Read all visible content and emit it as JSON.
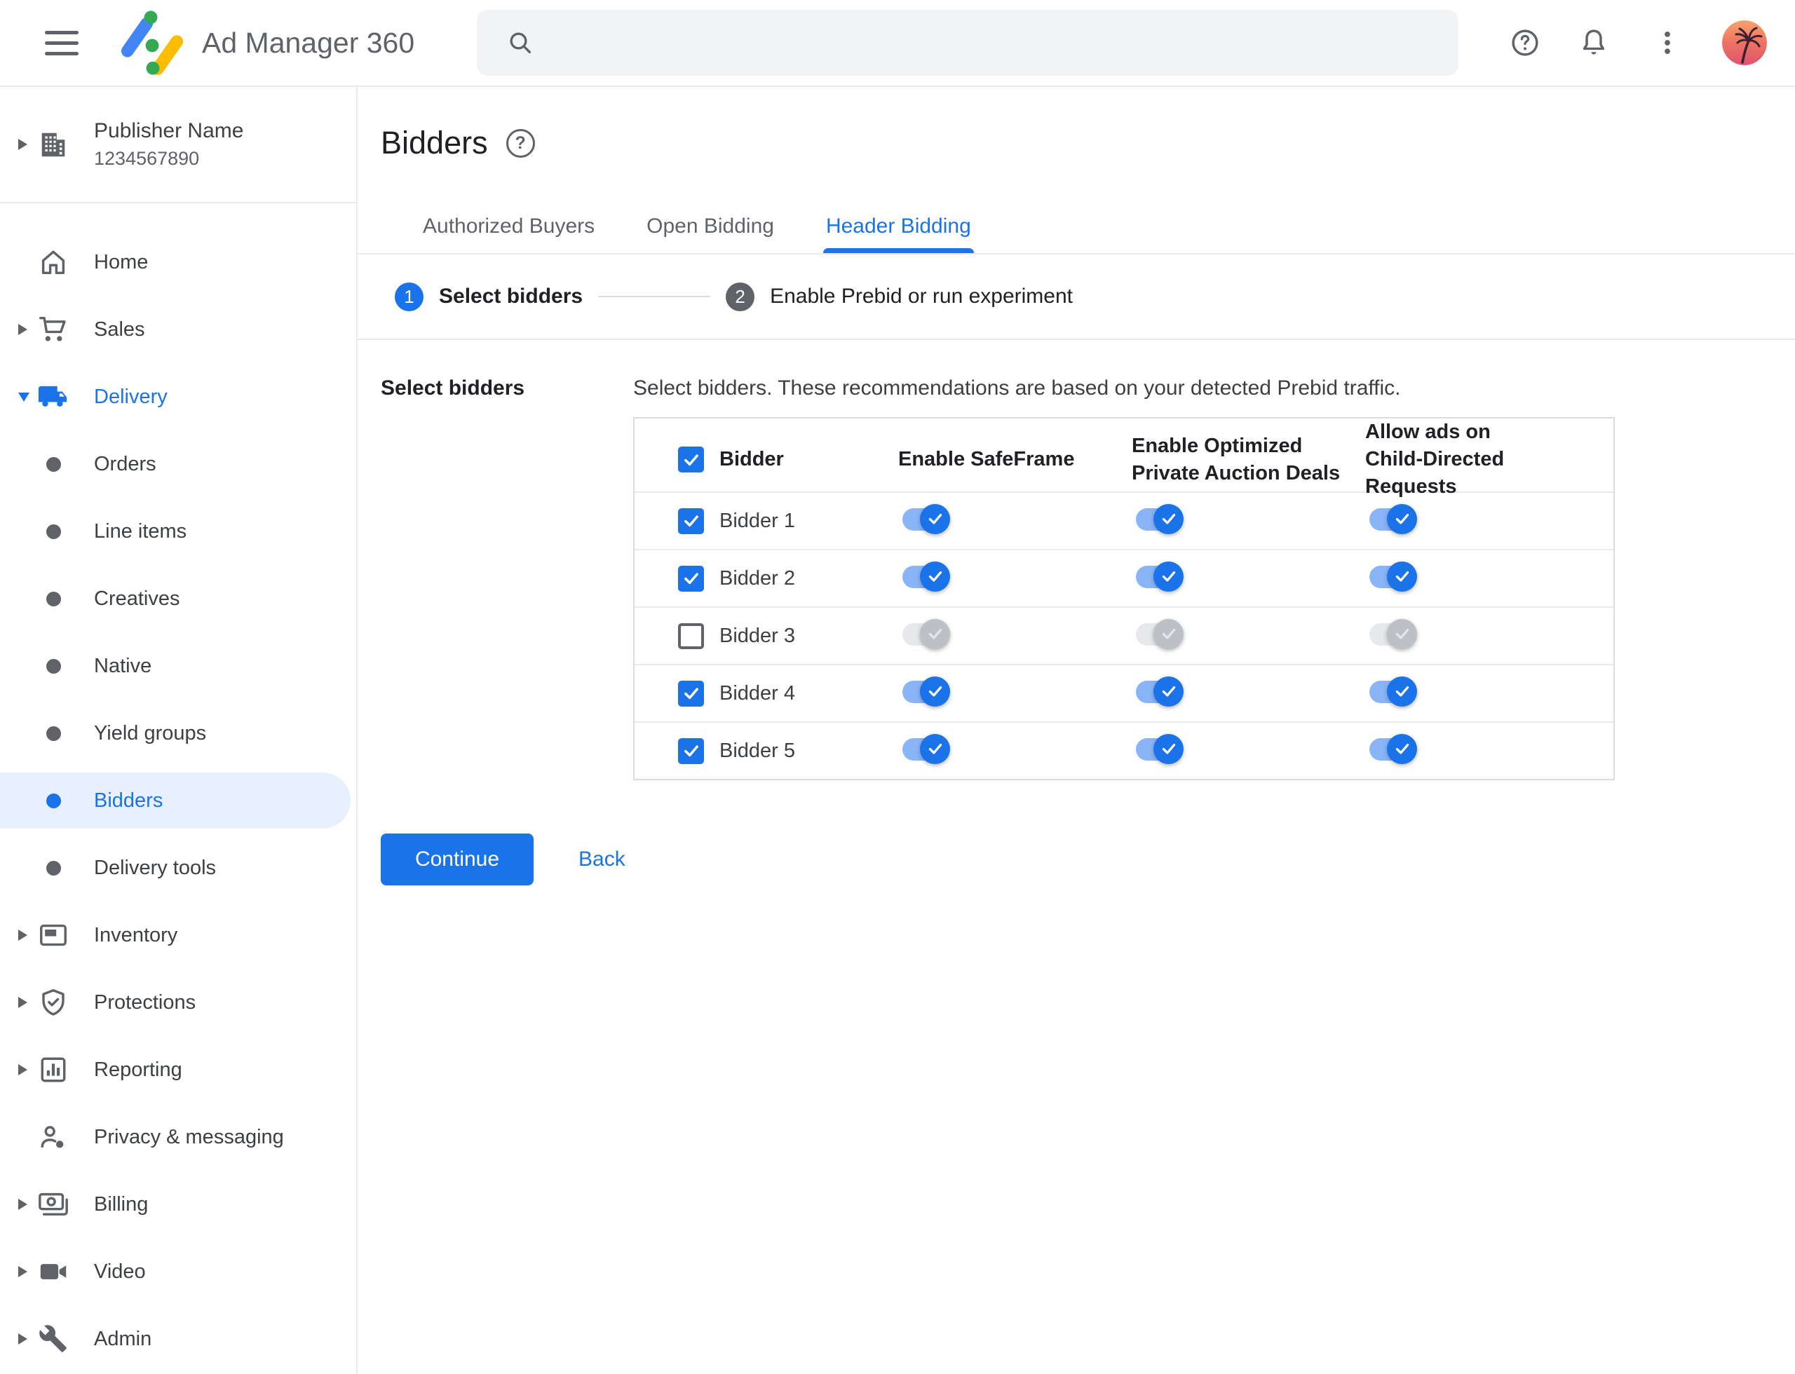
{
  "topbar": {
    "app_name": "Ad Manager 360",
    "search_value": "",
    "icons": {
      "menu": "hamburger-icon",
      "logo": "ad-manager-logo",
      "search": "search-icon",
      "help": "help-icon",
      "notifications": "bell-icon",
      "more": "more-vert-icon",
      "avatar": "palm-tree-avatar"
    }
  },
  "sidebar": {
    "publisher_name": "Publisher Name",
    "publisher_id": "1234567890",
    "items": [
      {
        "label": "Home",
        "icon": "home-icon"
      },
      {
        "label": "Sales",
        "icon": "cart-icon",
        "expandable": true
      },
      {
        "label": "Delivery",
        "icon": "truck-icon",
        "expandable": true,
        "expanded": true,
        "active": true
      },
      {
        "label": "Orders",
        "icon": "dot-icon",
        "child": true
      },
      {
        "label": "Line items",
        "icon": "dot-icon",
        "child": true
      },
      {
        "label": "Creatives",
        "icon": "dot-icon",
        "child": true
      },
      {
        "label": "Native",
        "icon": "dot-icon",
        "child": true
      },
      {
        "label": "Yield groups",
        "icon": "dot-icon",
        "child": true
      },
      {
        "label": "Bidders",
        "icon": "dot-icon",
        "child": true,
        "selected": true
      },
      {
        "label": "Delivery tools",
        "icon": "dot-icon",
        "child": true
      },
      {
        "label": "Inventory",
        "icon": "display-icon",
        "expandable": true
      },
      {
        "label": "Protections",
        "icon": "shield-check-icon",
        "expandable": true
      },
      {
        "label": "Reporting",
        "icon": "bar-chart-icon",
        "expandable": true
      },
      {
        "label": "Privacy & messaging",
        "icon": "person-dot-icon"
      },
      {
        "label": "Billing",
        "icon": "payments-icon",
        "expandable": true
      },
      {
        "label": "Video",
        "icon": "videocam-icon",
        "expandable": true
      },
      {
        "label": "Admin",
        "icon": "wrench-icon",
        "expandable": true
      }
    ]
  },
  "main": {
    "page_title": "Bidders",
    "tabs": [
      {
        "label": "Authorized Buyers",
        "active": false
      },
      {
        "label": "Open Bidding",
        "active": false
      },
      {
        "label": "Header Bidding",
        "active": true
      }
    ],
    "stepper": {
      "step1_number": "1",
      "step1_label": "Select bidders",
      "step2_number": "2",
      "step2_label": "Enable Prebid or run experiment"
    },
    "section_label": "Select bidders",
    "description": "Select bidders. These recommendations are based on your detected Prebid traffic.",
    "table": {
      "columns": [
        "Bidder",
        "Enable SafeFrame",
        "Enable Optimized Private Auction Deals",
        "Allow ads on Child-Directed Requests"
      ],
      "select_all_checked": true,
      "rows": [
        {
          "name": "Bidder 1",
          "checked": true,
          "safeframe": true,
          "optimized_deals": true,
          "child_directed": true
        },
        {
          "name": "Bidder 2",
          "checked": true,
          "safeframe": true,
          "optimized_deals": true,
          "child_directed": true
        },
        {
          "name": "Bidder 3",
          "checked": false,
          "safeframe": false,
          "optimized_deals": false,
          "child_directed": false
        },
        {
          "name": "Bidder 4",
          "checked": true,
          "safeframe": true,
          "optimized_deals": true,
          "child_directed": true
        },
        {
          "name": "Bidder 5",
          "checked": true,
          "safeframe": true,
          "optimized_deals": true,
          "child_directed": true
        }
      ]
    },
    "continue_button": "Continue",
    "back_link": "Back"
  },
  "colors": {
    "accent_blue": "#1a73e8",
    "selected_item_bg": "#e8f0fe",
    "toggle_track_on": "#8ab4f8",
    "toggle_thumb_off": "#bdc1c6",
    "table_border": "#dadce0",
    "divider": "#e8eaed",
    "text_primary": "#202124",
    "text_secondary": "#5f6368",
    "search_bg": "#f1f3f4"
  }
}
